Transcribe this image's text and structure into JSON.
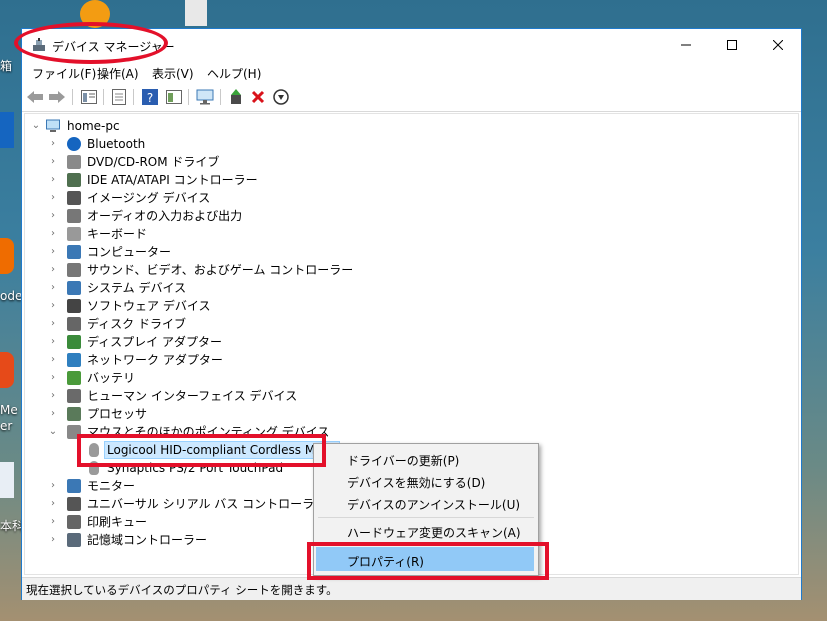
{
  "window": {
    "title": "デバイス マネージャー",
    "minimize_icon": "minimize-icon",
    "maximize_icon": "maximize-icon",
    "close_icon": "close-icon"
  },
  "menu": [
    "ファイル(F)",
    "操作(A)",
    "表示(V)",
    "ヘルプ(H)"
  ],
  "toolbar": {
    "icons": [
      "back-arrow-icon",
      "forward-arrow-icon",
      "show-hide-tree-icon",
      "properties-icon",
      "help-icon",
      "run-view-icon",
      "monitor-scan-icon",
      "update-driver-icon",
      "uninstall-x-icon",
      "download-disable-icon"
    ]
  },
  "tree": {
    "root": "home-pc",
    "categories": [
      {
        "label": "Bluetooth",
        "icon": "bluetooth-icon"
      },
      {
        "label": "DVD/CD-ROM ドライブ",
        "icon": "disc-drive-icon"
      },
      {
        "label": "IDE ATA/ATAPI コントローラー",
        "icon": "ide-controller-icon"
      },
      {
        "label": "イメージング デバイス",
        "icon": "camera-icon"
      },
      {
        "label": "オーディオの入力および出力",
        "icon": "speaker-icon"
      },
      {
        "label": "キーボード",
        "icon": "keyboard-icon"
      },
      {
        "label": "コンピューター",
        "icon": "computer-icon"
      },
      {
        "label": "サウンド、ビデオ、およびゲーム コントローラー",
        "icon": "sound-icon"
      },
      {
        "label": "システム デバイス",
        "icon": "system-device-icon"
      },
      {
        "label": "ソフトウェア デバイス",
        "icon": "software-device-icon"
      },
      {
        "label": "ディスク ドライブ",
        "icon": "disk-drive-icon"
      },
      {
        "label": "ディスプレイ アダプター",
        "icon": "display-adapter-icon"
      },
      {
        "label": "ネットワーク アダプター",
        "icon": "network-adapter-icon"
      },
      {
        "label": "バッテリ",
        "icon": "battery-icon"
      },
      {
        "label": "ヒューマン インターフェイス デバイス",
        "icon": "hid-icon"
      },
      {
        "label": "プロセッサ",
        "icon": "processor-icon"
      },
      {
        "label": "マウスとそのほかのポインティング デバイス",
        "icon": "mouse-icon"
      }
    ],
    "mouse_children": [
      "Logicool HID-compliant Cordless Mous",
      "Synaptics PS/2 Port TouchPad"
    ],
    "categories_after": [
      {
        "label": "モニター",
        "icon": "monitor-icon"
      },
      {
        "label": "ユニバーサル シリアル バス コントローラー",
        "icon": "usb-icon"
      },
      {
        "label": "印刷キュー",
        "icon": "printer-icon"
      },
      {
        "label": "記憶域コントローラー",
        "icon": "storage-controller-icon"
      }
    ]
  },
  "context_menu": {
    "items": [
      "ドライバーの更新(P)",
      "デバイスを無効にする(D)",
      "デバイスのアンインストール(U)",
      "ハードウェア変更のスキャン(A)",
      "プロパティ(R)"
    ],
    "selected": "プロパティ(R)"
  },
  "status": "現在選択しているデバイスのプロパティ シートを開きます。",
  "desktop": {
    "labels": [
      "箱",
      "ode",
      "Me",
      "er",
      "本科"
    ]
  },
  "colors": {
    "accent": "#1f7acc",
    "highlight": "#91c9f7",
    "annotation": "#e3102a"
  }
}
